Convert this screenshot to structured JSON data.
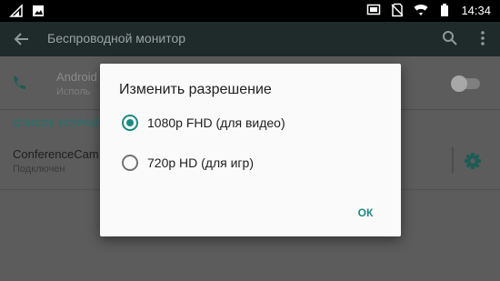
{
  "status_bar": {
    "time": "14:34",
    "left_icons": [
      "wifi-signal-icon",
      "image-notification-icon"
    ],
    "right_icons": [
      "cast-icon",
      "no-sim-icon",
      "wifi-icon",
      "battery-icon"
    ]
  },
  "toolbar": {
    "title": "Беспроводной монитор",
    "back_icon": "arrow-back-icon",
    "search_icon": "search-icon",
    "menu_icon": "more-vert-icon"
  },
  "settings": {
    "android_item": {
      "title": "Android",
      "subtitle": "Исполь",
      "toggle_on": false
    },
    "section_title": "СПИСОК УСТРОЙ",
    "device": {
      "name": "ConferenceCam",
      "status": "Подключен"
    }
  },
  "dialog": {
    "title": "Изменить разрешение",
    "options": [
      {
        "label": "1080p FHD (для видео)",
        "checked": true
      },
      {
        "label": "720p HD (для игр)",
        "checked": false
      }
    ],
    "ok_label": "ОК"
  },
  "colors": {
    "accent": "#1a8a80",
    "toolbar": "#1f2a2b",
    "scrim_background": "#5c5c5c"
  }
}
